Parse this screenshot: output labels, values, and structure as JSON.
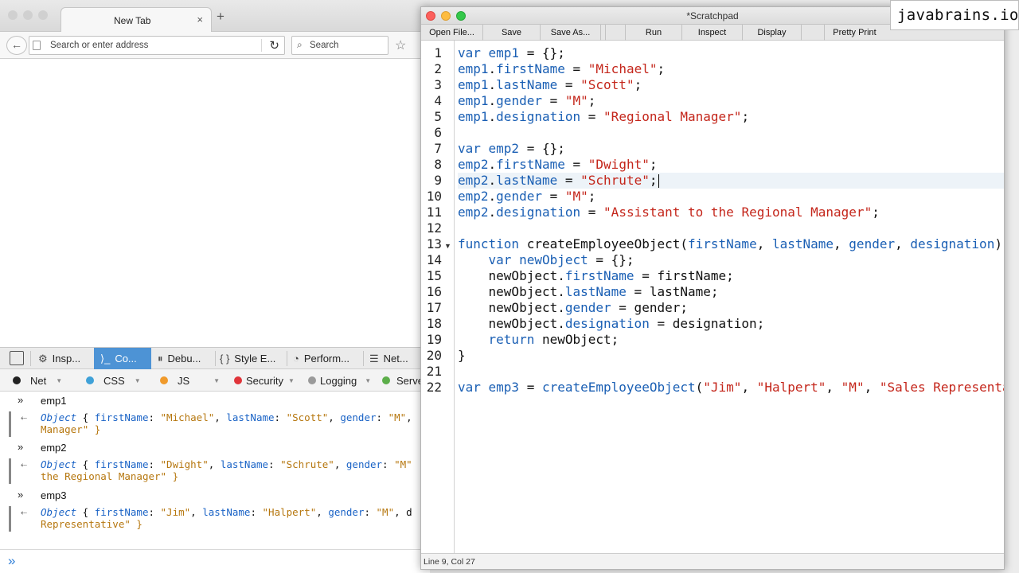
{
  "browser": {
    "tab_title": "New Tab",
    "tab_close": "×",
    "new_tab": "+",
    "back_icon": "←",
    "url_placeholder": "Search or enter address",
    "reload_icon": "↻",
    "search_placeholder": "Search",
    "search_icon": "⌕",
    "bookmark_icon": "☆"
  },
  "devtools": {
    "tabs": [
      {
        "label": "Insp...",
        "icon": "gear-icon",
        "glyph": "⚙"
      },
      {
        "label": "Co...",
        "icon": "console-icon",
        "glyph": "⟩_"
      },
      {
        "label": "Debu...",
        "icon": "pause-icon",
        "glyph": "⏸"
      },
      {
        "label": "Style E...",
        "icon": "braces-icon",
        "glyph": "{ }"
      },
      {
        "label": "Perform...",
        "icon": "speedometer-icon",
        "glyph": "◔"
      },
      {
        "label": "Net...",
        "icon": "network-icon",
        "glyph": "☰"
      }
    ],
    "filters": [
      {
        "label": "Net",
        "color": "#222222"
      },
      {
        "label": "CSS",
        "color": "#3fa1d8"
      },
      {
        "label": "JS",
        "color": "#f09a2b"
      },
      {
        "label": "Security",
        "color": "#e0343a"
      },
      {
        "label": "Logging",
        "color": "#9a9a9a"
      },
      {
        "label": "Serve",
        "color": "#5cae4a"
      }
    ],
    "console": [
      {
        "input": "emp1",
        "out_line1_prefix": "Object",
        "out_line1": " { firstName: \"Michael\", lastName: \"Scott\", gender: \"M\",",
        "out_line2": "Manager\" }"
      },
      {
        "input": "emp2",
        "out_line1_prefix": "Object",
        "out_line1": " { firstName: \"Dwight\", lastName: \"Schrute\", gender: \"M\"",
        "out_line2": "the Regional Manager\" }"
      },
      {
        "input": "emp3",
        "out_line1_prefix": "Object",
        "out_line1": " { firstName: \"Jim\", lastName: \"Halpert\", gender: \"M\", d",
        "out_line2": "Representative\" }"
      }
    ],
    "prompt": "»",
    "return_arrow": "⇠",
    "input_prompt": "»"
  },
  "scratchpad": {
    "title": "*Scratchpad",
    "toolbar": [
      "Open File...",
      "Save",
      "Save As...",
      "Run",
      "Inspect",
      "Display",
      "Pretty Print"
    ],
    "status": "Line 9, Col 27",
    "code_lines": [
      [
        [
          "k",
          "var "
        ],
        [
          "p",
          "emp1"
        ],
        [
          "t",
          " = {};"
        ]
      ],
      [
        [
          "p",
          "emp1"
        ],
        [
          "t",
          "."
        ],
        [
          "p",
          "firstName"
        ],
        [
          "t",
          " = "
        ],
        [
          "s",
          "\"Michael\""
        ],
        [
          "t",
          ";"
        ]
      ],
      [
        [
          "p",
          "emp1"
        ],
        [
          "t",
          "."
        ],
        [
          "p",
          "lastName"
        ],
        [
          "t",
          " = "
        ],
        [
          "s",
          "\"Scott\""
        ],
        [
          "t",
          ";"
        ]
      ],
      [
        [
          "p",
          "emp1"
        ],
        [
          "t",
          "."
        ],
        [
          "p",
          "gender"
        ],
        [
          "t",
          " = "
        ],
        [
          "s",
          "\"M\""
        ],
        [
          "t",
          ";"
        ]
      ],
      [
        [
          "p",
          "emp1"
        ],
        [
          "t",
          "."
        ],
        [
          "p",
          "designation"
        ],
        [
          "t",
          " = "
        ],
        [
          "s",
          "\"Regional Manager\""
        ],
        [
          "t",
          ";"
        ]
      ],
      [],
      [
        [
          "k",
          "var "
        ],
        [
          "p",
          "emp2"
        ],
        [
          "t",
          " = {};"
        ]
      ],
      [
        [
          "p",
          "emp2"
        ],
        [
          "t",
          "."
        ],
        [
          "p",
          "firstName"
        ],
        [
          "t",
          " = "
        ],
        [
          "s",
          "\"Dwight\""
        ],
        [
          "t",
          ";"
        ]
      ],
      [
        [
          "p",
          "emp2"
        ],
        [
          "t",
          "."
        ],
        [
          "p",
          "lastName"
        ],
        [
          "t",
          " = "
        ],
        [
          "s",
          "\"Schrute\""
        ],
        [
          "t",
          ";"
        ]
      ],
      [
        [
          "p",
          "emp2"
        ],
        [
          "t",
          "."
        ],
        [
          "p",
          "gender"
        ],
        [
          "t",
          " = "
        ],
        [
          "s",
          "\"M\""
        ],
        [
          "t",
          ";"
        ]
      ],
      [
        [
          "p",
          "emp2"
        ],
        [
          "t",
          "."
        ],
        [
          "p",
          "designation"
        ],
        [
          "t",
          " = "
        ],
        [
          "s",
          "\"Assistant to the Regional Manager\""
        ],
        [
          "t",
          ";"
        ]
      ],
      [],
      [
        [
          "k",
          "function "
        ],
        [
          "t",
          "createEmployeeObject("
        ],
        [
          "p",
          "firstName"
        ],
        [
          "t",
          ", "
        ],
        [
          "p",
          "lastName"
        ],
        [
          "t",
          ", "
        ],
        [
          "p",
          "gender"
        ],
        [
          "t",
          ", "
        ],
        [
          "p",
          "designation"
        ],
        [
          "t",
          ")"
        ]
      ],
      [
        [
          "t",
          "    "
        ],
        [
          "k",
          "var "
        ],
        [
          "p",
          "newObject"
        ],
        [
          "t",
          " = {};"
        ]
      ],
      [
        [
          "t",
          "    newObject."
        ],
        [
          "p",
          "firstName"
        ],
        [
          "t",
          " = firstName;"
        ]
      ],
      [
        [
          "t",
          "    newObject."
        ],
        [
          "p",
          "lastName"
        ],
        [
          "t",
          " = lastName;"
        ]
      ],
      [
        [
          "t",
          "    newObject."
        ],
        [
          "p",
          "gender"
        ],
        [
          "t",
          " = gender;"
        ]
      ],
      [
        [
          "t",
          "    newObject."
        ],
        [
          "p",
          "designation"
        ],
        [
          "t",
          " = designation;"
        ]
      ],
      [
        [
          "t",
          "    "
        ],
        [
          "k",
          "return "
        ],
        [
          "t",
          "newObject;"
        ]
      ],
      [
        [
          "t",
          "}"
        ]
      ],
      [],
      [
        [
          "k",
          "var "
        ],
        [
          "p",
          "emp3"
        ],
        [
          "t",
          " = "
        ],
        [
          "p",
          "createEmployeeObject"
        ],
        [
          "t",
          "("
        ],
        [
          "s",
          "\"Jim\""
        ],
        [
          "t",
          ", "
        ],
        [
          "s",
          "\"Halpert\""
        ],
        [
          "t",
          ", "
        ],
        [
          "s",
          "\"M\""
        ],
        [
          "t",
          ", "
        ],
        [
          "s",
          "\"Sales Representa"
        ]
      ]
    ],
    "fold_marker": "▼",
    "active_line": 9
  },
  "watermark": "javabrains.io"
}
